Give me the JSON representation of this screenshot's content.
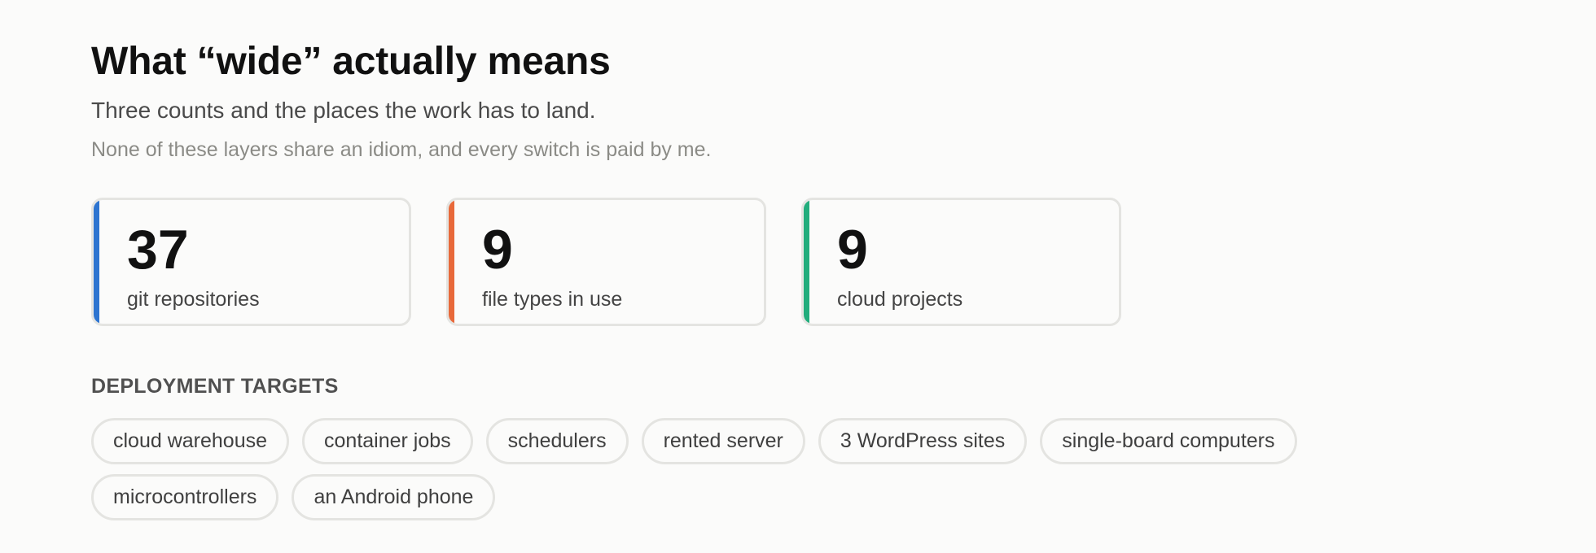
{
  "header": {
    "title": "What “wide” actually means",
    "subtitle": "Three counts and the places the work has to land.",
    "note": "None of these layers share an idiom, and every switch is paid by me."
  },
  "stats": [
    {
      "value": "37",
      "label": "git repositories",
      "accent": "#2d74d0"
    },
    {
      "value": "9",
      "label": "file types in use",
      "accent": "#e8693a"
    },
    {
      "value": "9",
      "label": "cloud projects",
      "accent": "#22ad7c"
    }
  ],
  "deployment": {
    "heading": "DEPLOYMENT TARGETS",
    "targets": [
      "cloud warehouse",
      "container jobs",
      "schedulers",
      "rented server",
      "3 WordPress sites",
      "single-board computers",
      "microcontrollers",
      "an Android phone"
    ]
  }
}
